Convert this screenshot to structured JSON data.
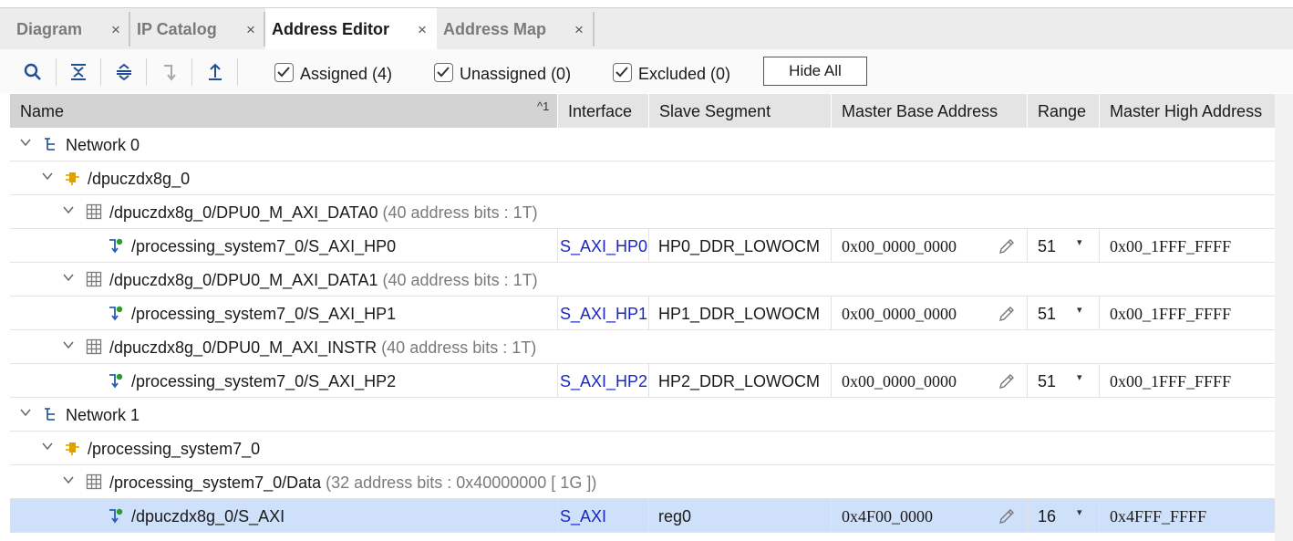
{
  "tabs": [
    {
      "label": "Diagram",
      "close": "×"
    },
    {
      "label": "IP Catalog",
      "close": "×"
    },
    {
      "label": "Address Editor",
      "close": "×"
    },
    {
      "label": "Address Map",
      "close": "×"
    }
  ],
  "toolbar": {
    "assigned_label": "Assigned (4)",
    "unassigned_label": "Unassigned (0)",
    "excluded_label": "Excluded (0)",
    "hide_all_label": "Hide All",
    "icons": [
      "search-icon",
      "collapse-all-icon",
      "expand-all-icon",
      "move-down-icon",
      "move-up-icon"
    ]
  },
  "columns": {
    "name": "Name",
    "sort_indicator": "^1",
    "interface": "Interface",
    "slave_segment": "Slave Segment",
    "master_base": "Master Base Address",
    "range": "Range",
    "master_high": "Master High Address"
  },
  "rows": [
    {
      "name": "Network 0"
    },
    {
      "name": "/dpuczdx8g_0"
    },
    {
      "name": "/dpuczdx8g_0/DPU0_M_AXI_DATA0",
      "extra": "(40 address bits : 1T)"
    },
    {
      "name": "/processing_system7_0/S_AXI_HP0",
      "interface": "S_AXI_HP0",
      "slave_segment": "HP0_DDR_LOWOCM",
      "base": "0x00_0000_0000",
      "range": "51",
      "high": "0x00_1FFF_FFFF"
    },
    {
      "name": "/dpuczdx8g_0/DPU0_M_AXI_DATA1",
      "extra": "(40 address bits : 1T)"
    },
    {
      "name": "/processing_system7_0/S_AXI_HP1",
      "interface": "S_AXI_HP1",
      "slave_segment": "HP1_DDR_LOWOCM",
      "base": "0x00_0000_0000",
      "range": "51",
      "high": "0x00_1FFF_FFFF"
    },
    {
      "name": "/dpuczdx8g_0/DPU0_M_AXI_INSTR",
      "extra": "(40 address bits : 1T)"
    },
    {
      "name": "/processing_system7_0/S_AXI_HP2",
      "interface": "S_AXI_HP2",
      "slave_segment": "HP2_DDR_LOWOCM",
      "base": "0x00_0000_0000",
      "range": "51",
      "high": "0x00_1FFF_FFFF"
    },
    {
      "name": "Network 1"
    },
    {
      "name": "/processing_system7_0"
    },
    {
      "name": "/processing_system7_0/Data",
      "extra": "(32 address bits : 0x40000000 [ 1G ])"
    },
    {
      "name": "/dpuczdx8g_0/S_AXI",
      "interface": "S_AXI",
      "slave_segment": "reg0",
      "base": "0x4F00_0000",
      "range": "16",
      "high": "0x4FFF_FFFF"
    }
  ],
  "colors": {
    "selected_row": "#cfe0fa",
    "link": "#1a25c8",
    "network_icon": "#1a4b8c",
    "ip_icon": "#e0a000",
    "slave_icon": "#2a9d2a"
  }
}
